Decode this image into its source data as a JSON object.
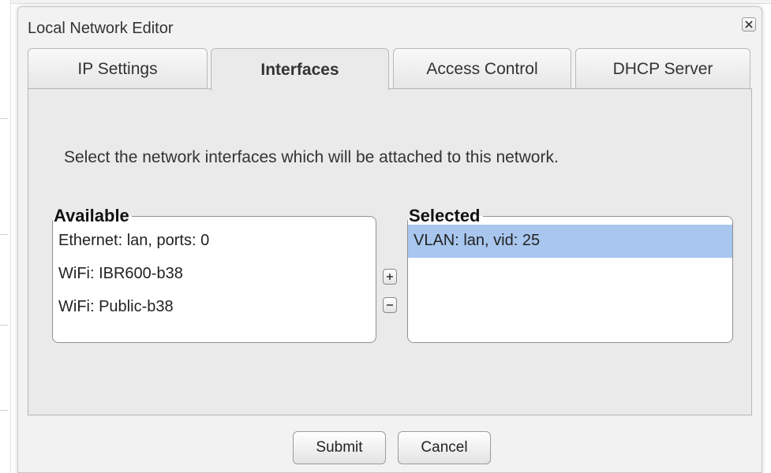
{
  "dialog": {
    "title": "Local Network Editor",
    "close_icon": "close-icon"
  },
  "tabs": [
    {
      "label": "IP Settings",
      "active": false
    },
    {
      "label": "Interfaces",
      "active": true
    },
    {
      "label": "Access Control",
      "active": false
    },
    {
      "label": "DHCP Server",
      "active": false
    }
  ],
  "interfaces_panel": {
    "instruction": "Select the network interfaces which will be attached to this network.",
    "available": {
      "legend": "Available",
      "items": [
        "Ethernet: lan, ports: 0",
        "WiFi: IBR600-b38",
        "WiFi: Public-b38"
      ]
    },
    "selected": {
      "legend": "Selected",
      "items": [
        {
          "label": "VLAN: lan, vid: 25",
          "highlighted": true
        }
      ]
    },
    "add_icon": "plus-icon",
    "remove_icon": "minus-icon"
  },
  "footer": {
    "submit_label": "Submit",
    "cancel_label": "Cancel"
  },
  "colors": {
    "selection_highlight": "#a8c6ee",
    "panel_background": "#eaeaea",
    "dialog_background": "#f2f2f2"
  }
}
